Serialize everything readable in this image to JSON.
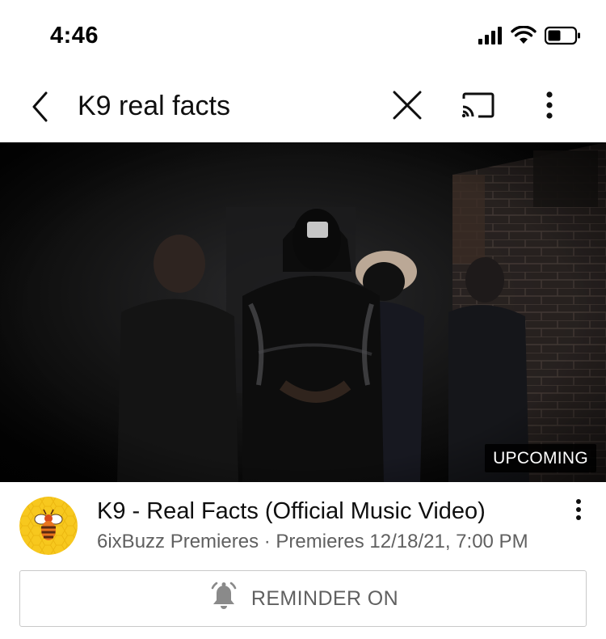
{
  "status_bar": {
    "time": "4:46",
    "icons": [
      "cellular-signal-icon",
      "wifi-icon",
      "battery-icon"
    ]
  },
  "search_bar": {
    "query": "K9 real facts",
    "icons": [
      "back-arrow-icon",
      "clear-x-icon",
      "cast-icon",
      "more-vertical-icon"
    ]
  },
  "video": {
    "badge": "UPCOMING",
    "title": "K9 - Real Facts (Official Music Video)",
    "meta": "6ixBuzz Premieres · Premieres 12/18/21, 7:00 PM",
    "channel_avatar": "bee-icon"
  },
  "reminder_button": {
    "label": "REMINDER ON",
    "icon": "bell-ringing-icon"
  },
  "colors": {
    "text_primary": "#0f0f0f",
    "text_secondary": "#606060",
    "avatar_yellow": "#f5c518",
    "button_border": "#c9c9c9"
  }
}
